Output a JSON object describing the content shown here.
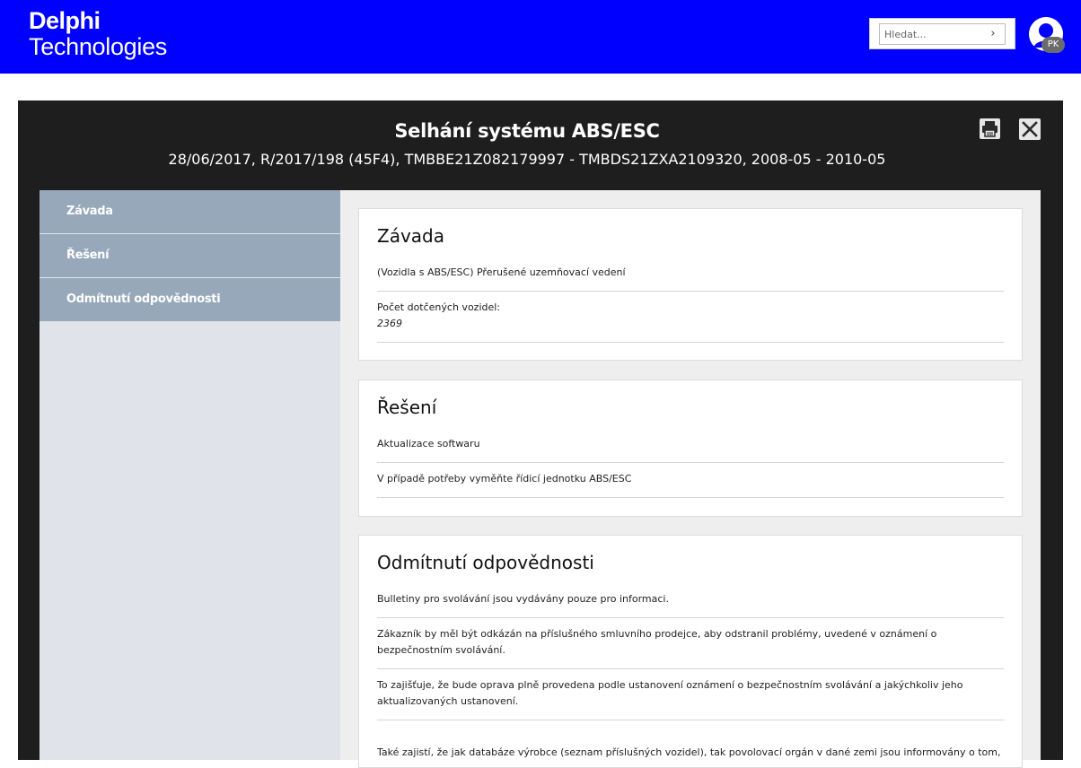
{
  "header": {
    "logo_line1": "Delphi",
    "logo_line2": "Technologies",
    "search_placeholder": "Hledat...",
    "user_initials": "PK"
  },
  "modal": {
    "title": "Selhání systému ABS/ESC",
    "subtitle": "28/06/2017, R/2017/198 (45F4), TMBBE21Z082179997 - TMBDS21ZXA2109320, 2008-05 - 2010-05"
  },
  "sidebar": {
    "items": [
      {
        "label": "Závada"
      },
      {
        "label": "Řešení"
      },
      {
        "label": "Odmítnutí odpovědnosti"
      }
    ]
  },
  "sections": {
    "defect": {
      "title": "Závada",
      "description": "(Vozidla s ABS/ESC) Přerušené uzemňovací vedení",
      "count_label": "Počet dotčených vozidel:",
      "count_value": "2369"
    },
    "solution": {
      "title": "Řešení",
      "items": [
        "Aktualizace softwaru",
        "V případě potřeby vyměňte řídicí jednotku ABS/ESC"
      ]
    },
    "disclaimer": {
      "title": "Odmítnutí odpovědnosti",
      "paragraphs": [
        "Bulletiny pro svolávání jsou vydávány pouze pro informaci.",
        "Zákazník by měl být odkázán na příslušného smluvního prodejce, aby odstranil problémy, uvedené v oznámení o bezpečnostním svolávání.",
        "To zajišťuje, že bude oprava plně provedena podle ustanovení oznámení o bezpečnostním svolávání a jakýchkoliv jeho aktualizovaných ustanovení.",
        "Také zajistí, že jak databáze výrobce (seznam příslušných vozidel), tak povolovací orgán v dané zemi jsou informovány o tom,"
      ]
    }
  },
  "colors": {
    "header_bg": "#0000ff",
    "modal_bg": "#1e1e1e",
    "sidebar_item_bg": "#97a8ba",
    "sidebar_bg": "#e0e4ea"
  }
}
